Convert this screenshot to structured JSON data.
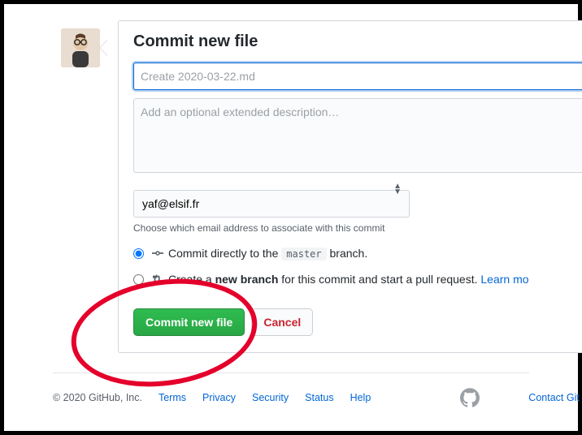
{
  "commit": {
    "heading": "Commit new file",
    "subject_placeholder": "Create 2020-03-22.md",
    "description_placeholder": "Add an optional extended description…",
    "email_selected": "yaf@elsif.fr",
    "email_helper": "Choose which email address to associate with this commit",
    "direct": {
      "prefix": "Commit directly to the ",
      "branch": "master",
      "suffix": " branch."
    },
    "newbranch": {
      "prefix": "Create a ",
      "bold": "new branch",
      "suffix": " for this commit and start a pull request. ",
      "learn": "Learn mo"
    },
    "commit_btn": "Commit new file",
    "cancel_btn": "Cancel"
  },
  "footer": {
    "copyright": "© 2020 GitHub, Inc.",
    "links": {
      "terms": "Terms",
      "privacy": "Privacy",
      "security": "Security",
      "status": "Status",
      "help": "Help"
    },
    "contact": "Contact Git"
  }
}
